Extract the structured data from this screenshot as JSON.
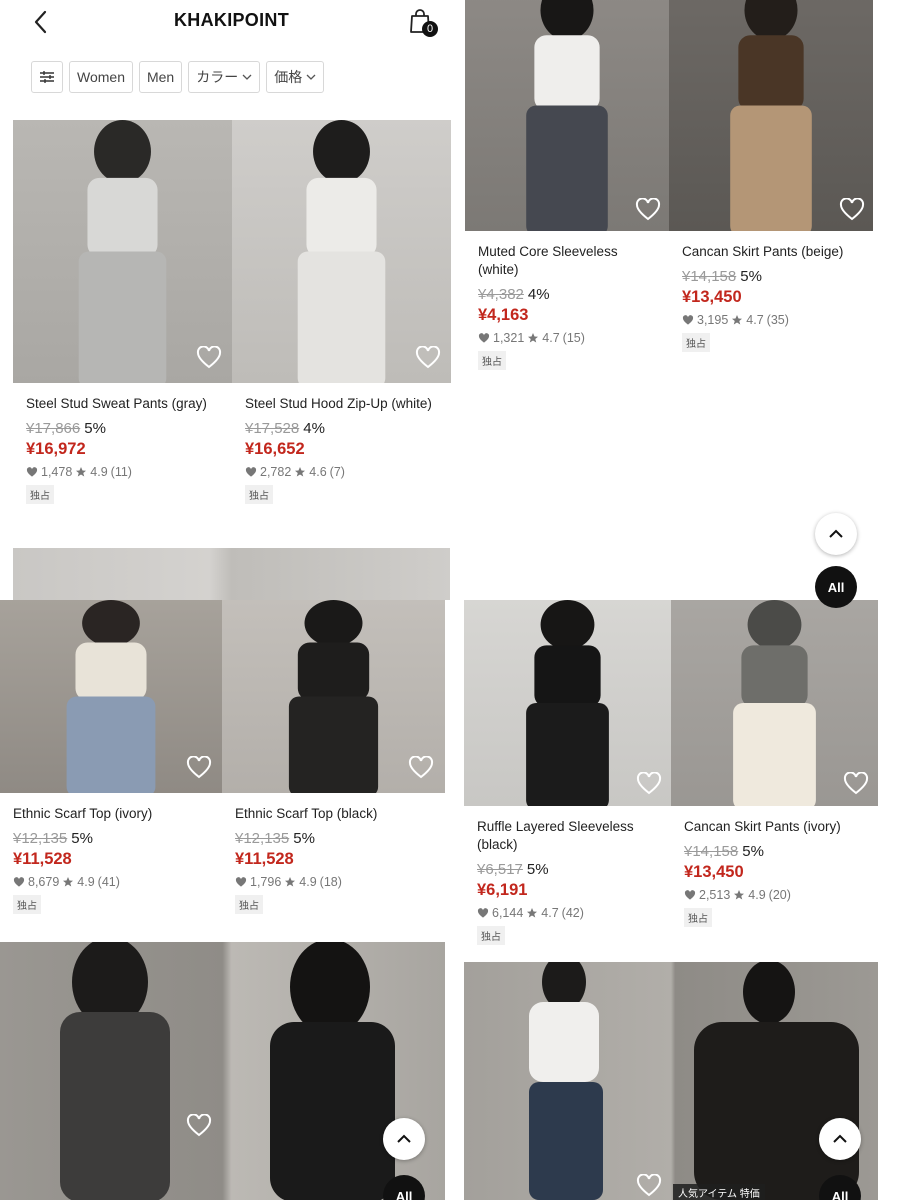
{
  "header": {
    "brand": "KHAKIPOINT",
    "cart_count": "0"
  },
  "filters": {
    "women": "Women",
    "men": "Men",
    "color": "カラー",
    "price": "価格"
  },
  "products": [
    {
      "name": "Steel Stud Sweat Pants (gray)",
      "old_price": "¥17,866",
      "discount": "5%",
      "price": "¥16,972",
      "likes": "1,478",
      "rating": "4.9",
      "reviews": "(11)",
      "tag": "独占"
    },
    {
      "name": "Steel Stud Hood Zip-Up (white)",
      "old_price": "¥17,528",
      "discount": "4%",
      "price": "¥16,652",
      "likes": "2,782",
      "rating": "4.6",
      "reviews": "(7)",
      "tag": "独占"
    },
    {
      "name": "Muted Core Sleeveless (white)",
      "old_price": "¥4,382",
      "discount": "4%",
      "price": "¥4,163",
      "likes": "1,321",
      "rating": "4.7",
      "reviews": "(15)",
      "tag": "独占"
    },
    {
      "name": "Cancan Skirt Pants (beige)",
      "old_price": "¥14,158",
      "discount": "5%",
      "price": "¥13,450",
      "likes": "3,195",
      "rating": "4.7",
      "reviews": "(35)",
      "tag": "独占"
    },
    {
      "name": "Ethnic Scarf Top (ivory)",
      "old_price": "¥12,135",
      "discount": "5%",
      "price": "¥11,528",
      "likes": "8,679",
      "rating": "4.9",
      "reviews": "(41)",
      "tag": "独占"
    },
    {
      "name": "Ethnic Scarf Top (black)",
      "old_price": "¥12,135",
      "discount": "5%",
      "price": "¥11,528",
      "likes": "1,796",
      "rating": "4.9",
      "reviews": "(18)",
      "tag": "独占"
    },
    {
      "name": "Ruffle Layered Sleeveless (black)",
      "old_price": "¥6,517",
      "discount": "5%",
      "price": "¥6,191",
      "likes": "6,144",
      "rating": "4.7",
      "reviews": "(42)",
      "tag": "独占"
    },
    {
      "name": "Cancan Skirt Pants (ivory)",
      "old_price": "¥14,158",
      "discount": "5%",
      "price": "¥13,450",
      "likes": "2,513",
      "rating": "4.9",
      "reviews": "(20)",
      "tag": "独占"
    }
  ],
  "floating": {
    "all_label": "All"
  },
  "promo_badge": "人気アイテム 特価",
  "colors": {
    "price_red": "#c2271d",
    "strike_gray": "#9a9a9a",
    "badge_black": "#111111"
  },
  "icons": [
    "back-icon",
    "cart-icon",
    "filter-icon",
    "chevron-down-icon",
    "heart-icon",
    "star-icon",
    "chevron-up-icon"
  ]
}
